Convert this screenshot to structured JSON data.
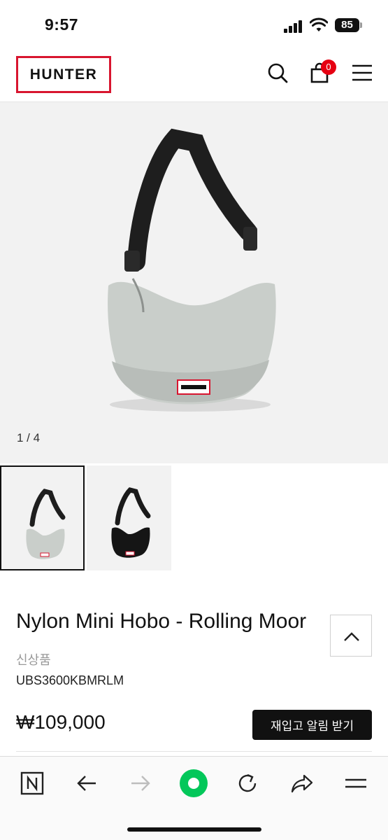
{
  "status_bar": {
    "time": "9:57",
    "battery": "85"
  },
  "header": {
    "logo": "HUNTER",
    "cart_count": "0"
  },
  "gallery": {
    "counter": "1 / 4",
    "main_image": "product-photo-hobo-bag-grey",
    "thumbnails": [
      "thumbnail-grey-bag",
      "thumbnail-black-bag"
    ]
  },
  "product": {
    "title": "Nylon Mini Hobo - Rolling Moor",
    "new_badge": "신상품",
    "sku": "UBS3600KBMRLM",
    "price": "₩109,000",
    "restock_button": "재입고 알림 받기"
  },
  "toolbar": {
    "items": [
      "naver-icon",
      "back-icon",
      "forward-icon",
      "green-dot-icon",
      "refresh-icon",
      "share-icon",
      "menu-icon"
    ]
  },
  "colors": {
    "brand_red": "#d8152f",
    "badge_red": "#e60012",
    "bag_grey": "#c9ceca",
    "strap_black": "#1e1e1e",
    "green_accent": "#03c75a"
  }
}
